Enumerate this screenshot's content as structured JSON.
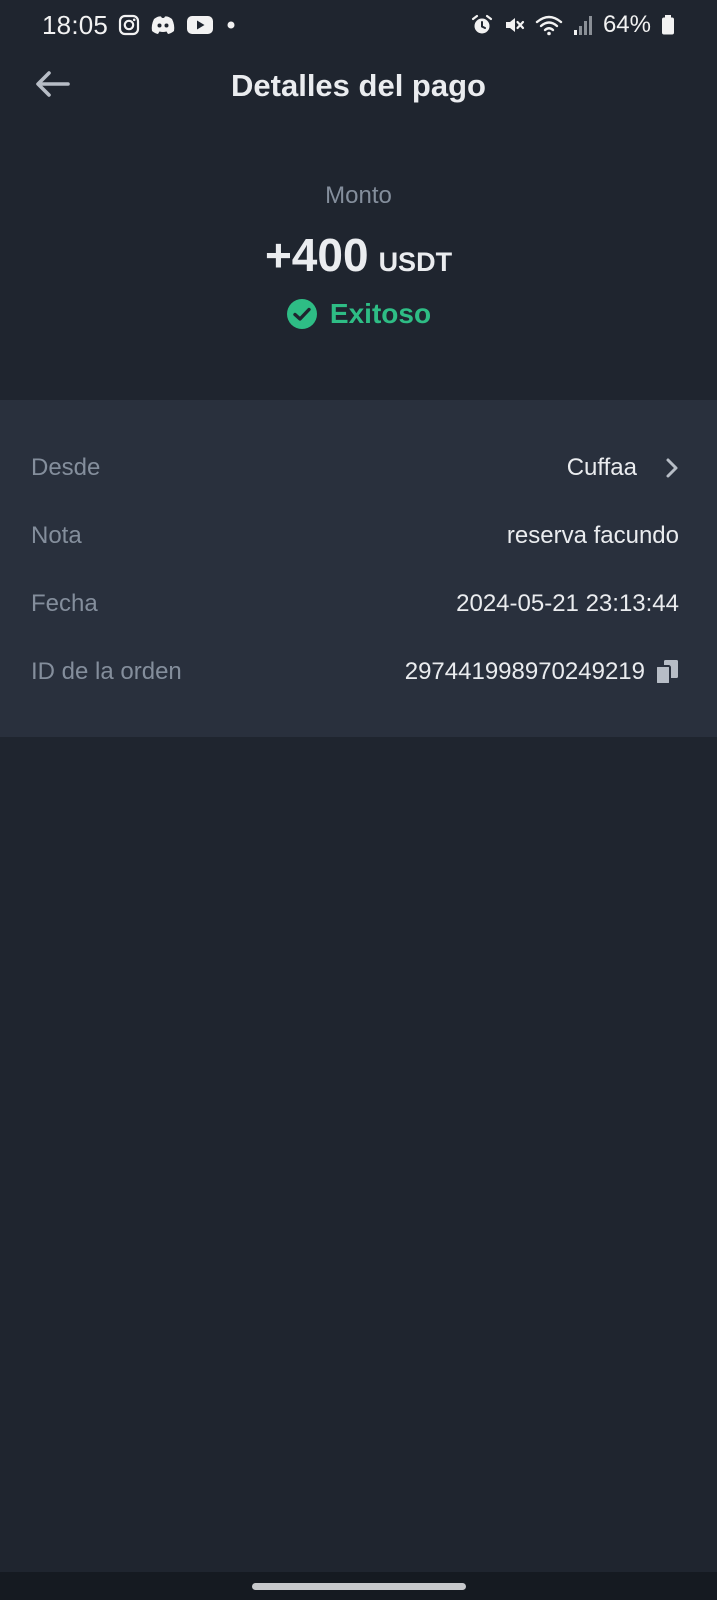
{
  "status_bar": {
    "time": "18:05",
    "battery": "64%",
    "icons_left": [
      "instagram-icon",
      "discord-icon",
      "youtube-icon",
      "dot-icon"
    ],
    "icons_right": [
      "alarm-icon",
      "mute-icon",
      "wifi-icon",
      "signal-icon",
      "battery-icon"
    ]
  },
  "header": {
    "title": "Detalles del pago",
    "back_icon": "arrow-left-icon"
  },
  "amount": {
    "label": "Monto",
    "value": "+400",
    "unit": "USDT",
    "status": "Exitoso",
    "status_icon": "check-circle-icon"
  },
  "details": {
    "rows": [
      {
        "label": "Desde",
        "value": "Cuffaa",
        "icon": "chevron-right-icon"
      },
      {
        "label": "Nota",
        "value": "reserva facundo"
      },
      {
        "label": "Fecha",
        "value": "2024-05-21 23:13:44"
      },
      {
        "label": "ID de la orden",
        "value": "297441998970249219",
        "icon": "copy-icon"
      }
    ]
  },
  "colors": {
    "background": "#1f252f",
    "card": "#29303d",
    "success": "#2ebd85",
    "secondary_text": "#848e9c",
    "primary_text": "#eaecef"
  }
}
